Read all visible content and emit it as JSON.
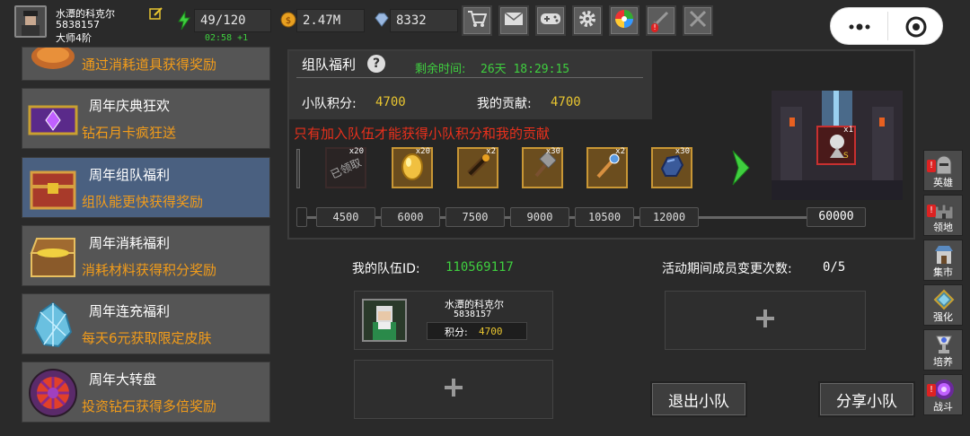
{
  "player": {
    "name": "水潭的科克尔",
    "id": "5838157",
    "rank": "大师4阶"
  },
  "resources": {
    "energy": "49/120",
    "energy_timer": "02:58 +1",
    "gold": "2.47M",
    "diamonds": "8332"
  },
  "top_buttons": [
    "cart-icon",
    "mail-icon",
    "gamepad-icon",
    "gear-icon",
    "color-wheel-icon",
    "sword-icon",
    "crossed-swords-icon"
  ],
  "events": [
    {
      "title": "",
      "desc": "通过消耗道具获得奖励"
    },
    {
      "title": "周年庆典狂欢",
      "desc": "钻石月卡疯狂送"
    },
    {
      "title": "周年组队福利",
      "desc": "组队能更快获得奖励"
    },
    {
      "title": "周年消耗福利",
      "desc": "消耗材料获得积分奖励"
    },
    {
      "title": "周年连充福利",
      "desc": "每天6元获取限定皮肤"
    },
    {
      "title": "周年大转盘",
      "desc": "投资钻石获得多倍奖励"
    }
  ],
  "team": {
    "title": "组队福利",
    "remaining_label": "剩余时间:",
    "remaining": "26天 18:29:15",
    "team_points_label": "小队积分:",
    "team_points": "4700",
    "my_contrib_label": "我的贡献:",
    "my_contrib": "4700",
    "notice": "只有加入队伍才能获得小队积分和我的贡献",
    "claimed_label": "已领取",
    "rewards": [
      {
        "count": "x20",
        "icon": "claimed-icon"
      },
      {
        "count": "x20",
        "icon": "egg-icon"
      },
      {
        "count": "x2",
        "icon": "scroll-icon"
      },
      {
        "count": "x30",
        "icon": "hammer-icon"
      },
      {
        "count": "x2",
        "icon": "staff-icon"
      },
      {
        "count": "x30",
        "icon": "ore-icon"
      }
    ],
    "thresholds": [
      "4500",
      "6000",
      "7500",
      "9000",
      "10500",
      "12000",
      "60000"
    ],
    "big_reward_count": "x1",
    "progress_fraction": 0.0
  },
  "my_team": {
    "id_label": "我的队伍ID:",
    "id": "110569117",
    "changes_label": "活动期间成员变更次数:",
    "changes": "0/5",
    "member_name": "水潭的科克尔",
    "member_id": "5838157",
    "member_points_label": "积分:",
    "member_points": "4700",
    "leave_label": "退出小队",
    "share_label": "分享小队"
  },
  "side_nav": [
    {
      "label": "英雄",
      "badge": "!"
    },
    {
      "label": "领地",
      "badge": "!"
    },
    {
      "label": "集市",
      "badge": ""
    },
    {
      "label": "强化",
      "badge": ""
    },
    {
      "label": "培养",
      "badge": ""
    },
    {
      "label": "战斗",
      "badge": "!"
    }
  ],
  "colors": {
    "accent_orange": "#f29c1a",
    "accent_green": "#3fcf3f",
    "accent_yellow": "#e8c530",
    "warning_red": "#e8301c",
    "selected_bg": "#4a6080"
  }
}
